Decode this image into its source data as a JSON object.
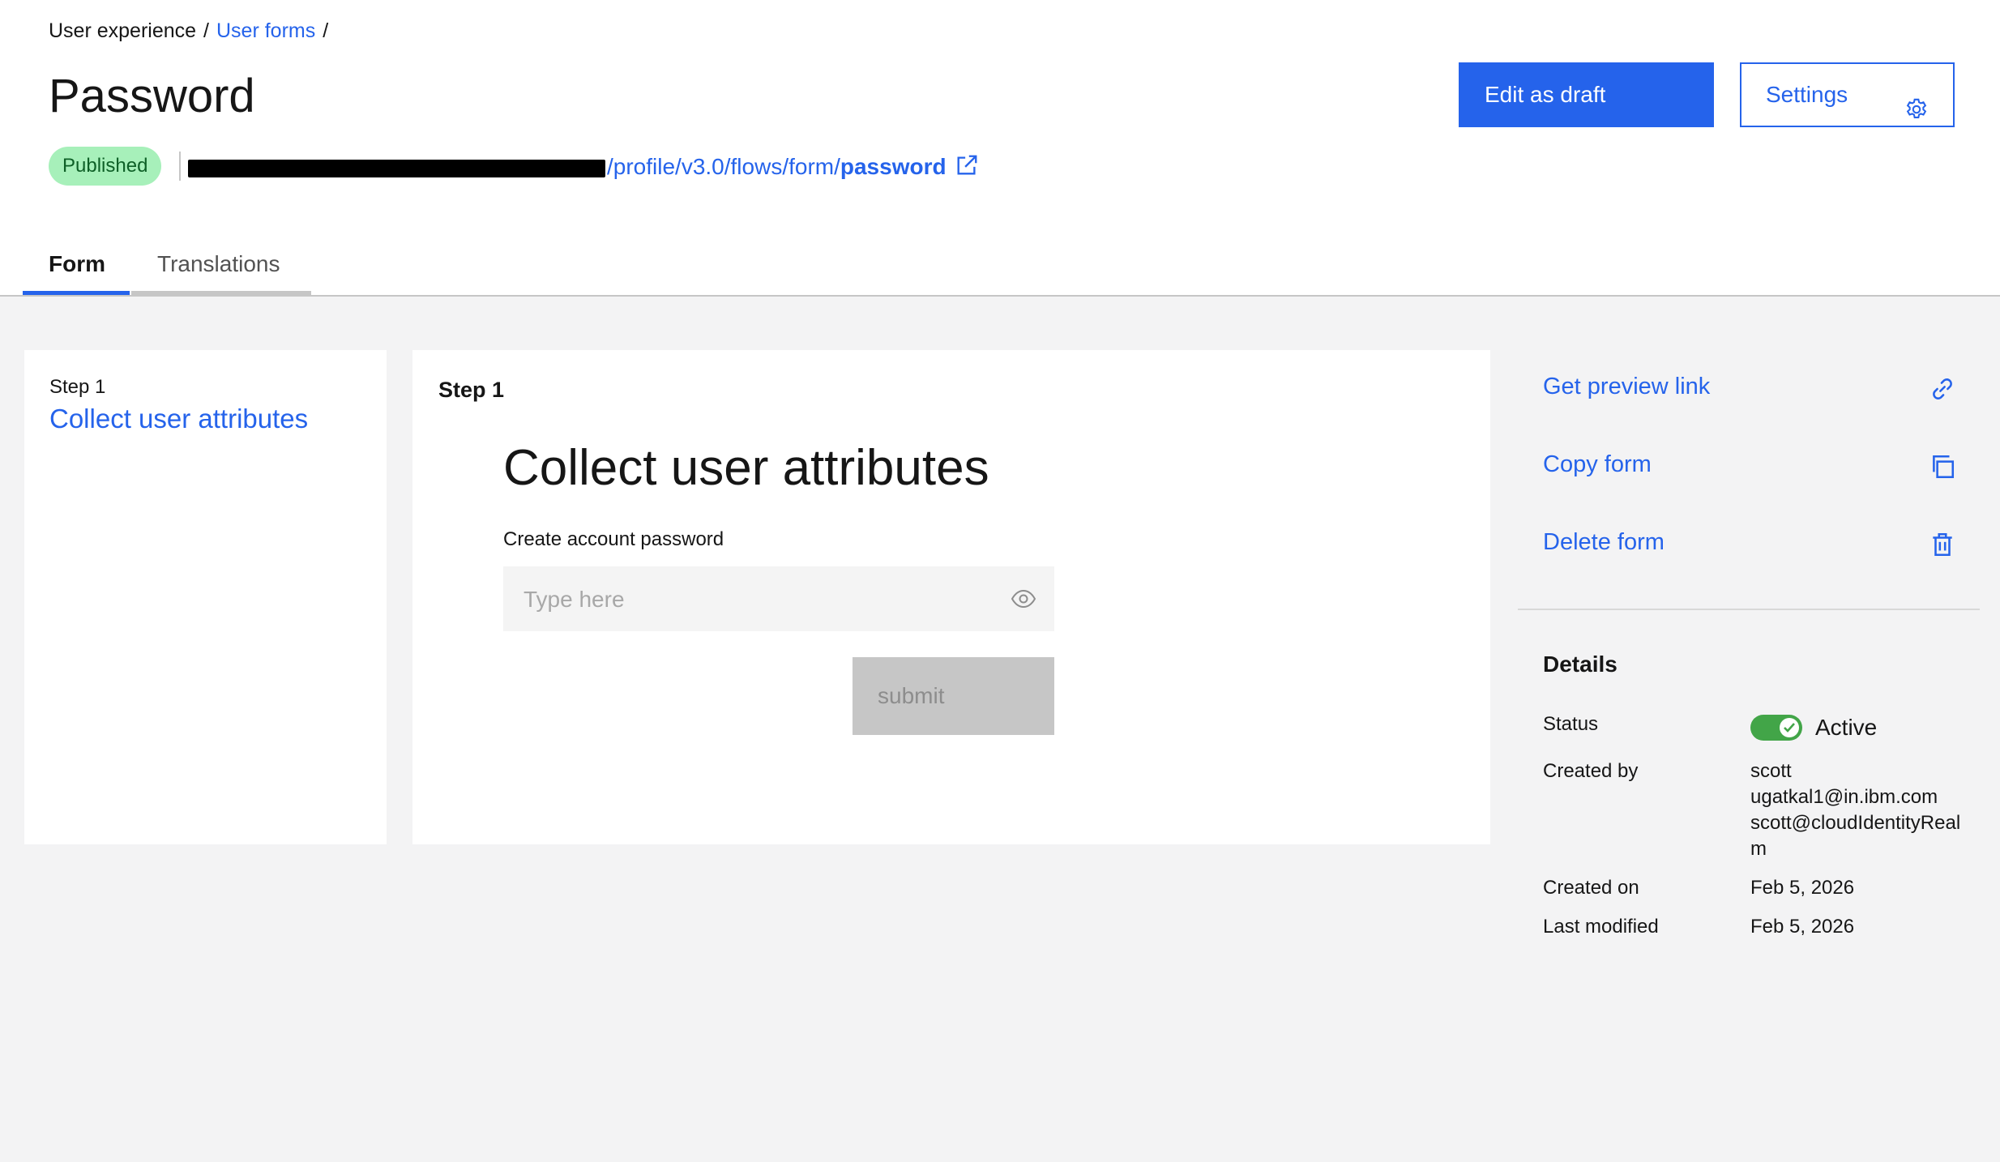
{
  "breadcrumb": {
    "item1": "User experience",
    "sep": "/",
    "item2": "User forms"
  },
  "page": {
    "title": "Password",
    "status_badge": "Published",
    "url_path": "/profile/v3.0/flows/form/",
    "url_bold": "password"
  },
  "toolbar": {
    "edit_label": "Edit as draft",
    "settings_label": "Settings"
  },
  "tabs": [
    {
      "label": "Form",
      "selected": true
    },
    {
      "label": "Translations",
      "selected": false
    }
  ],
  "steps": {
    "step_label": "Step 1",
    "step_title": "Collect user attributes"
  },
  "preview": {
    "step_heading": "Step 1",
    "form_heading": "Collect user attributes",
    "field_label": "Create account password",
    "field_placeholder": "Type here",
    "submit_label": "submit"
  },
  "actions": {
    "preview_link": "Get preview link",
    "copy_form": "Copy form",
    "delete_form": "Delete form"
  },
  "details": {
    "title": "Details",
    "status_label": "Status",
    "status_value": "Active",
    "status_on": true,
    "created_by_label": "Created by",
    "created_by_lines": [
      "scott",
      "ugatkal1@in.ibm.com",
      "scott@cloudIdentityReal",
      "m"
    ],
    "created_on_label": "Created on",
    "created_on_value": "Feb 5, 2026",
    "last_modified_label": "Last modified",
    "last_modified_value": "Feb 5, 2026"
  },
  "colors": {
    "accent": "#2563eb",
    "badge_bg": "#a7f0ba",
    "toggle_on": "#42a548"
  }
}
